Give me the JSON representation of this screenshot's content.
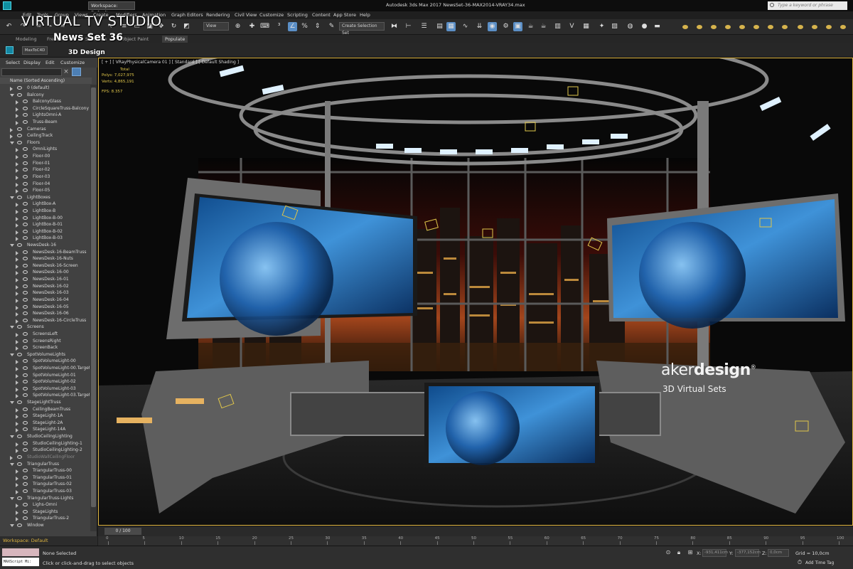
{
  "app": {
    "window_title": "Autodesk 3ds Max 2017      NewsSet-36-MAX2014-VRAY34.max",
    "workspace": "Workspace: Default",
    "search_placeholder": "Type a keyword or phrase"
  },
  "menus": [
    "Edit",
    "Tools",
    "Group",
    "Views",
    "Create",
    "Modifiers",
    "Animation",
    "Graph Editors",
    "Rendering",
    "Civil View",
    "Customize",
    "Scripting",
    "Content",
    "App Store",
    "Help"
  ],
  "toolbar": {
    "view_combo": "View",
    "selection_set": "Create Selection Set"
  },
  "ribbon_tabs": [
    "Modeling",
    "Freeform",
    "Selection",
    "Object Paint",
    "Populate"
  ],
  "plugin_button": "MaxToC4D",
  "overlay": {
    "title": "VIRTUAL TV STUDIO",
    "subtitle": "News Set 36",
    "tag": "3D Design"
  },
  "explorer": {
    "menu": [
      "Select",
      "Display",
      "Edit",
      "Customize"
    ],
    "column_header": "Name (Sorted Ascending)",
    "rows": [
      {
        "label": "0 (default)",
        "level": 1,
        "expand": "collapsed"
      },
      {
        "label": "Balcony",
        "level": 1,
        "expand": "open"
      },
      {
        "label": "BalconyGlass",
        "level": 2
      },
      {
        "label": "CircleSquareTruss-Balcony",
        "level": 2
      },
      {
        "label": "LightsOmni-A",
        "level": 2
      },
      {
        "label": "Truss-Beam",
        "level": 2
      },
      {
        "label": "Cameras",
        "level": 1,
        "expand": "collapsed"
      },
      {
        "label": "CeilingTrack",
        "level": 1,
        "expand": "collapsed"
      },
      {
        "label": "Floors",
        "level": 1,
        "expand": "open"
      },
      {
        "label": "OmniLights",
        "level": 2
      },
      {
        "label": "Floor-00",
        "level": 2
      },
      {
        "label": "Floor-01",
        "level": 2
      },
      {
        "label": "Floor-02",
        "level": 2
      },
      {
        "label": "Floor-03",
        "level": 2
      },
      {
        "label": "Floor-04",
        "level": 2
      },
      {
        "label": "Floor-05",
        "level": 2
      },
      {
        "label": "LightBoxes",
        "level": 1,
        "expand": "open"
      },
      {
        "label": "LightBox-A",
        "level": 2
      },
      {
        "label": "LightBox-B",
        "level": 2
      },
      {
        "label": "LightBox-B-00",
        "level": 2
      },
      {
        "label": "LightBox-B-01",
        "level": 2
      },
      {
        "label": "LightBox-B-02",
        "level": 2
      },
      {
        "label": "LightBox-B-03",
        "level": 2
      },
      {
        "label": "NewsDesk-16",
        "level": 1,
        "expand": "open"
      },
      {
        "label": "NewsDesk-16-BeamTruss",
        "level": 2
      },
      {
        "label": "NewsDesk-16-Nuts",
        "level": 2
      },
      {
        "label": "NewsDesk-16-Screen",
        "level": 2
      },
      {
        "label": "NewsDesk-16-00",
        "level": 2
      },
      {
        "label": "NewsDesk-16-01",
        "level": 2
      },
      {
        "label": "NewsDesk-16-02",
        "level": 2
      },
      {
        "label": "NewsDesk-16-03",
        "level": 2
      },
      {
        "label": "NewsDesk-16-04",
        "level": 2
      },
      {
        "label": "NewsDesk-16-05",
        "level": 2
      },
      {
        "label": "NewsDesk-16-06",
        "level": 2
      },
      {
        "label": "NewsDesk-16-CircleTruss",
        "level": 2
      },
      {
        "label": "Screens",
        "level": 1,
        "expand": "open"
      },
      {
        "label": "ScreensLeft",
        "level": 2
      },
      {
        "label": "ScreensRight",
        "level": 2
      },
      {
        "label": "ScreenBack",
        "level": 2
      },
      {
        "label": "SpotVolumeLights",
        "level": 1,
        "expand": "open"
      },
      {
        "label": "SpotVolumeLight-00",
        "level": 2
      },
      {
        "label": "SpotVolumeLight-00.Target",
        "level": 2
      },
      {
        "label": "SpotVolumeLight-01",
        "level": 2
      },
      {
        "label": "SpotVolumeLight-02",
        "level": 2
      },
      {
        "label": "SpotVolumeLight-03",
        "level": 2
      },
      {
        "label": "SpotVolumeLight-03.Target",
        "level": 2
      },
      {
        "label": "StageLightTruss",
        "level": 1,
        "expand": "open"
      },
      {
        "label": "CeilingBeamTruss",
        "level": 2
      },
      {
        "label": "StageLight-1A",
        "level": 2
      },
      {
        "label": "StageLight-2A",
        "level": 2
      },
      {
        "label": "StageLight-14A",
        "level": 2
      },
      {
        "label": "StudioCeilingLighting",
        "level": 1,
        "expand": "open"
      },
      {
        "label": "StudioCeilingLighting-1",
        "level": 2
      },
      {
        "label": "StudioCeilingLighting-2",
        "level": 2
      },
      {
        "label": "StudioWallCeilingFloor",
        "level": 1,
        "expand": "collapsed",
        "muted": true
      },
      {
        "label": "TriangularTruss",
        "level": 1,
        "expand": "open"
      },
      {
        "label": "TriangularTruss-00",
        "level": 2
      },
      {
        "label": "TriangularTruss-01",
        "level": 2
      },
      {
        "label": "TriangularTruss-02",
        "level": 2
      },
      {
        "label": "TriangularTruss-03",
        "level": 2
      },
      {
        "label": "TriangularTruss-Lights",
        "level": 1,
        "expand": "open"
      },
      {
        "label": "Lighs-Omni",
        "level": 2
      },
      {
        "label": "StageLights",
        "level": 2
      },
      {
        "label": "TriangularTruss-2",
        "level": 2
      },
      {
        "label": "Window",
        "level": 1,
        "expand": "open"
      }
    ]
  },
  "viewport": {
    "label": "[ + ] [ VRayPhysicalCamera 01 ] [ Standard ] [ Default Shading ]",
    "stats": {
      "total_label": "Total",
      "polys": "Polys:   7,027,975",
      "verts": "Verts:   4,865,191",
      "fps": "FPS:      8.357"
    },
    "watermark": {
      "brand_a": "aker",
      "brand_b": "design",
      "reg": "®",
      "subtitle": "3D Virtual Sets"
    }
  },
  "timeline": {
    "slider": "0 / 100",
    "ticks": [
      "0",
      "5",
      "10",
      "15",
      "20",
      "25",
      "30",
      "35",
      "40",
      "45",
      "50",
      "55",
      "60",
      "65",
      "70",
      "75",
      "80",
      "85",
      "90",
      "95",
      "100"
    ]
  },
  "status": {
    "workspace": "Workspace: Default",
    "maxscript": "MAXScript Mi:",
    "selected": "None Selected",
    "prompt": "Click or click-and-drag to select objects",
    "x_label": "X:",
    "x_value": "-931,411cm",
    "y_label": "Y:",
    "y_value": "-377,152cm",
    "z_label": "Z:",
    "z_value": "0,0cm",
    "grid": "Grid = 10,0cm",
    "add_time_tag": "Add Time Tag"
  },
  "colors": {
    "accent_blue": "#5b8fc6",
    "viewport_border": "#e0b640",
    "stats_yellow": "#e0c64a"
  }
}
